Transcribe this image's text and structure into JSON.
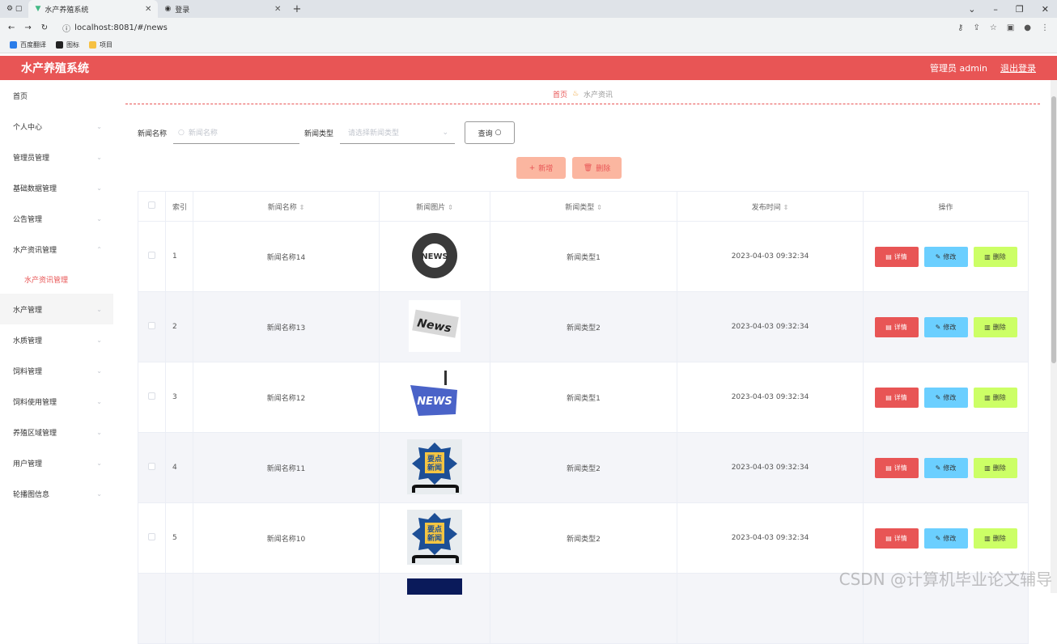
{
  "browser": {
    "tabs": [
      {
        "title": "水产养殖系统",
        "active": true
      },
      {
        "title": "登录",
        "active": false
      }
    ],
    "url": "localhost:8081/#/news",
    "bookmarks": [
      "百度翻译",
      "图标",
      "项目"
    ]
  },
  "header": {
    "title": "水产养殖系统",
    "user": "管理员 admin",
    "logout": "退出登录",
    "color": "#e85555"
  },
  "sidebar": {
    "items": [
      {
        "label": "首页"
      },
      {
        "label": "个人中心"
      },
      {
        "label": "管理员管理"
      },
      {
        "label": "基础数据管理"
      },
      {
        "label": "公告管理"
      },
      {
        "label": "水产资讯管理"
      },
      {
        "label": "水产资讯管理"
      },
      {
        "label": "水产管理"
      },
      {
        "label": "水质管理"
      },
      {
        "label": "饲料管理"
      },
      {
        "label": "饲料使用管理"
      },
      {
        "label": "养殖区域管理"
      },
      {
        "label": "用户管理"
      },
      {
        "label": "轮播图信息"
      }
    ]
  },
  "breadcrumb": {
    "home": "首页",
    "current": "水产资讯"
  },
  "search": {
    "name_label": "新闻名称",
    "name_placeholder": "新闻名称",
    "type_label": "新闻类型",
    "type_placeholder": "请选择新闻类型",
    "query_button": "查询"
  },
  "actions": {
    "add": "新增",
    "delete": "删除"
  },
  "table": {
    "headers": [
      "索引",
      "新闻名称",
      "新闻图片",
      "新闻类型",
      "发布时间",
      "操作"
    ],
    "rows": [
      {
        "index": "1",
        "name": "新闻名称14",
        "type": "新闻类型1",
        "time": "2023-04-03 09:32:34"
      },
      {
        "index": "2",
        "name": "新闻名称13",
        "type": "新闻类型2",
        "time": "2023-04-03 09:32:34"
      },
      {
        "index": "3",
        "name": "新闻名称12",
        "type": "新闻类型1",
        "time": "2023-04-03 09:32:34"
      },
      {
        "index": "4",
        "name": "新闻名称11",
        "type": "新闻类型2",
        "time": "2023-04-03 09:32:34"
      },
      {
        "index": "5",
        "name": "新闻名称10",
        "type": "新闻类型2",
        "time": "2023-04-03 09:32:34"
      }
    ],
    "row_actions": {
      "detail": "详情",
      "edit": "修改",
      "remove": "删除"
    }
  },
  "watermark": "CSDN @计算机毕业论文辅导"
}
